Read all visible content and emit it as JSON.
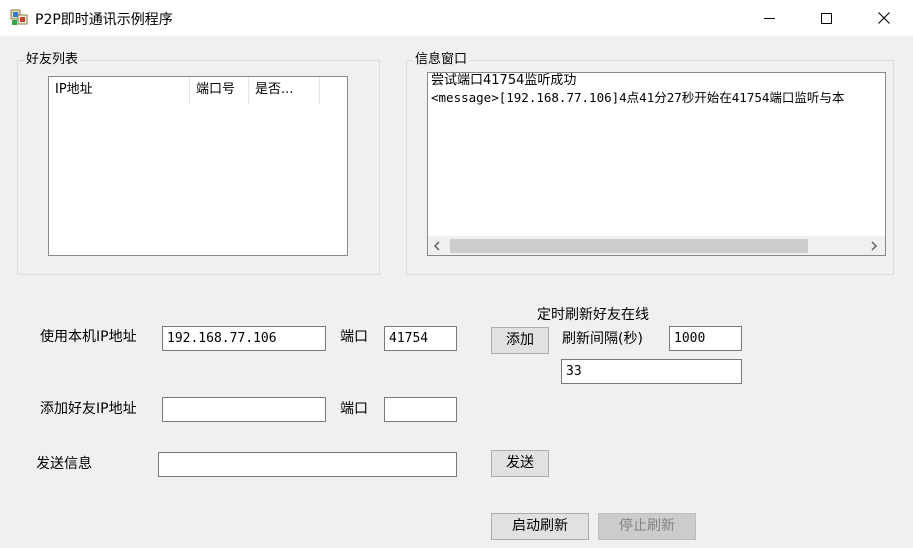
{
  "window": {
    "title": "P2P即时通讯示例程序",
    "controls": {
      "minimize": "—",
      "maximize": "☐",
      "close": "✕"
    }
  },
  "friends_group": {
    "legend": "好友列表",
    "columns": [
      "IP地址",
      "端口号",
      "是否..."
    ]
  },
  "message_group": {
    "legend": "信息窗口",
    "lines": [
      "尝试端口41754监听成功",
      "<message>[192.168.77.106]4点41分27秒开始在41754端口监听与本"
    ]
  },
  "local": {
    "ip_label": "使用本机IP地址",
    "ip_value": "192.168.77.106",
    "port_label": "端口",
    "port_value": "41754"
  },
  "friend": {
    "ip_label": "添加好友IP地址",
    "ip_value": "",
    "port_label": "端口",
    "port_value": ""
  },
  "refresh": {
    "heading": "定时刷新好友在线",
    "add_label": "添加",
    "interval_label": "刷新间隔(秒)",
    "interval_value": "1000",
    "extra_value": "33"
  },
  "send": {
    "label": "发送信息",
    "value": "",
    "button_label": "发送"
  },
  "actions": {
    "start_refresh": "启动刷新",
    "stop_refresh": "停止刷新"
  }
}
